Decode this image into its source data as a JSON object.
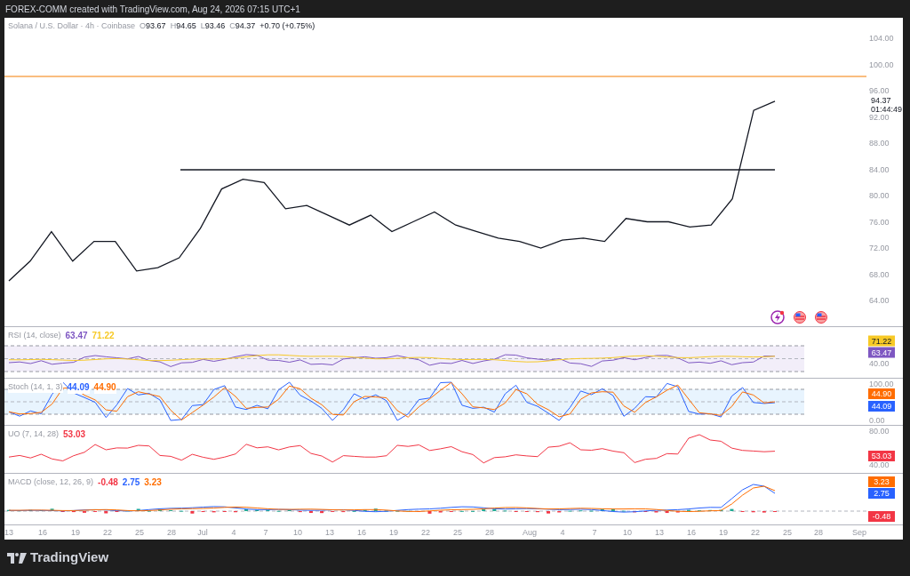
{
  "top_bar": {
    "text": "FOREX-COMM created with TradingView.com, Aug 24, 2026 07:15 UTC+1"
  },
  "main": {
    "symbol": "Solana / U.S. Dollar · 4h · Coinbase",
    "ohlc": [
      {
        "label": "O",
        "value": "93.67"
      },
      {
        "label": "H",
        "value": "94.65"
      },
      {
        "label": "L",
        "value": "93.46"
      },
      {
        "label": "C",
        "value": "94.37"
      }
    ],
    "change": "+0.70 (+0.75%)",
    "last_price": "94.37",
    "countdown": "01:44:49",
    "axis_labels": [
      "104.00",
      "100.00",
      "96.00",
      "92.00",
      "88.00",
      "84.00",
      "80.00",
      "76.00",
      "72.00",
      "68.00",
      "64.00"
    ]
  },
  "indicators": [
    {
      "kind": "rsi",
      "title": "RSI (14, close)",
      "legend": [
        {
          "text": "63.47",
          "color": "#7e57c2"
        },
        {
          "text": "71.22",
          "color": "#f7c926"
        }
      ],
      "badges": [
        {
          "text": "71.22",
          "color": "#f7c926"
        },
        {
          "text": "63.47",
          "color": "#7e57c2"
        }
      ],
      "axis_labels": [
        "40.00"
      ]
    },
    {
      "kind": "stoch",
      "title": "Stoch (14, 1, 3)",
      "legend": [
        {
          "text": "44.09",
          "color": "#2962ff"
        },
        {
          "text": "44.90",
          "color": "#ff6d00"
        }
      ],
      "badges": [
        {
          "text": "44.90",
          "color": "#ff6d00"
        },
        {
          "text": "44.09",
          "color": "#2962ff"
        }
      ],
      "axis_labels": [
        "100.00",
        "0.00"
      ]
    },
    {
      "kind": "uo",
      "title": "UO (7, 14, 28)",
      "legend": [
        {
          "text": "53.03",
          "color": "#f23645"
        }
      ],
      "badges": [
        {
          "text": "53.03",
          "color": "#f23645"
        }
      ],
      "axis_labels": [
        "80.00",
        "40.00"
      ]
    },
    {
      "kind": "macd",
      "title": "MACD (close, 12, 26, 9)",
      "legend": [
        {
          "text": "-0.48",
          "color": "#f23645"
        },
        {
          "text": "2.75",
          "color": "#2962ff"
        },
        {
          "text": "3.23",
          "color": "#ff6d00"
        }
      ],
      "badges": [
        {
          "text": "3.23",
          "color": "#ff6d00"
        },
        {
          "text": "2.75",
          "color": "#2962ff"
        },
        {
          "text": "-0.48",
          "color": "#f23645"
        }
      ]
    }
  ],
  "time_axis": [
    "13",
    "16",
    "19",
    "22",
    "25",
    "28",
    "Jul",
    "4",
    "7",
    "10",
    "13",
    "16",
    "19",
    "22",
    "25",
    "28",
    "Aug",
    "4",
    "7",
    "10",
    "13",
    "16",
    "19",
    "22",
    "25",
    "28",
    "Sep"
  ],
  "footer": {
    "brand": "TradingView"
  }
}
